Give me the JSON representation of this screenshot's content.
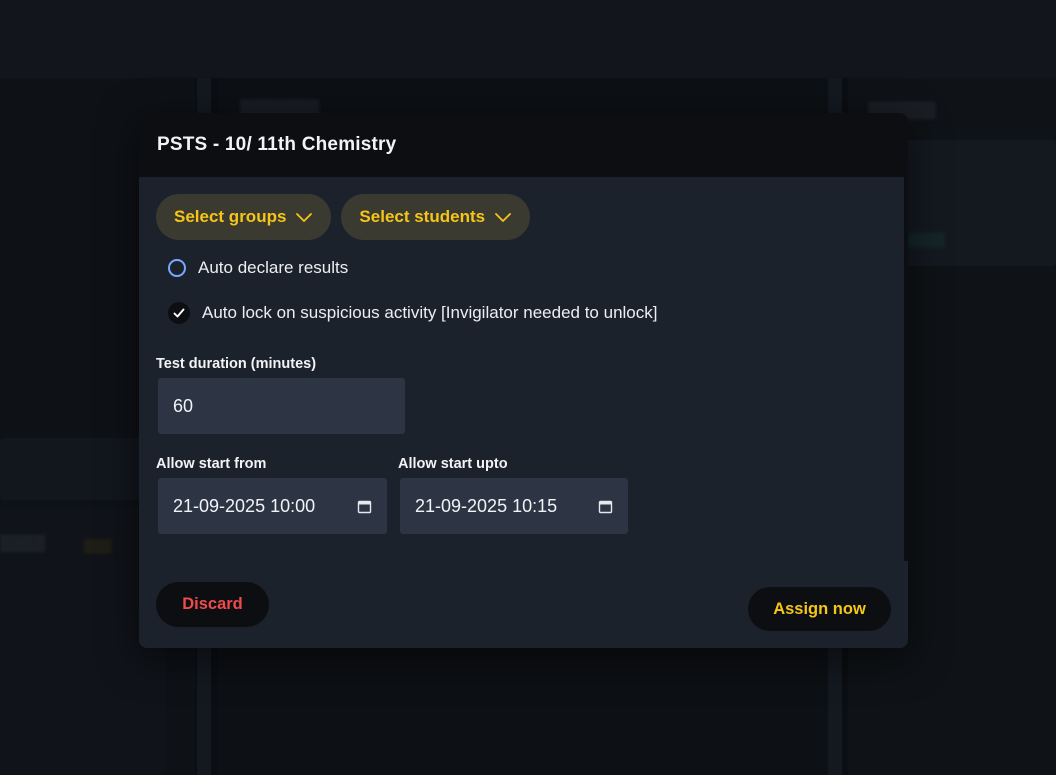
{
  "modal": {
    "title": "PSTS - 10/ 11th Chemistry",
    "selectors": {
      "groups_label": "Select groups",
      "students_label": "Select students"
    },
    "options": {
      "auto_declare_label": "Auto declare results",
      "auto_declare_checked": false,
      "auto_lock_label": "Auto lock on suspicious activity [Invigilator needed to unlock]",
      "auto_lock_checked": true
    },
    "duration": {
      "label": "Test duration (minutes)",
      "value": "60"
    },
    "start_from": {
      "label": "Allow start from",
      "value": "21-09-2025 10:00"
    },
    "start_upto": {
      "label": "Allow start upto",
      "value": "21-09-2025 10:15"
    },
    "buttons": {
      "discard_label": "Discard",
      "assign_label": "Assign now"
    }
  },
  "icons": {
    "selector_chevron": "chevron-down-icon",
    "checkbox_mark": "checkmark-icon",
    "calendar": "calendar-icon"
  },
  "colors": {
    "accent_yellow": "#f5c518",
    "danger_red": "#ef4b4b",
    "radio_blue": "#7aa7ff",
    "modal_bg": "#1c222c",
    "header_bg": "#0c0e12",
    "input_bg": "#2d3545"
  }
}
